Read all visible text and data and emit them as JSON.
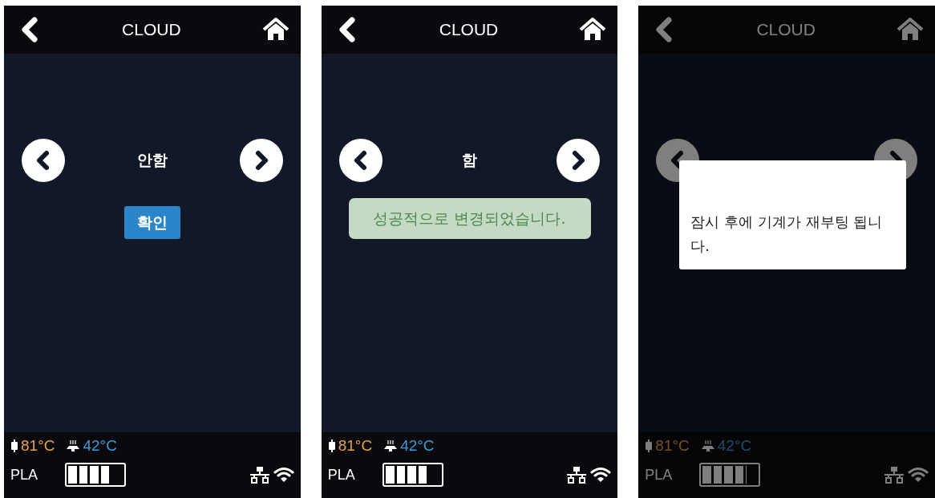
{
  "screens": [
    {
      "title": "CLOUD",
      "dimmed": false,
      "value": "안함",
      "confirm_button": "확인",
      "status": {
        "nozzle_temp": "81°C",
        "bed_temp": "42°C",
        "material": "PLA",
        "level": 0.8
      }
    },
    {
      "title": "CLOUD",
      "dimmed": false,
      "value": "함",
      "toast": "성공적으로 변경되었습니다.",
      "status": {
        "nozzle_temp": "81°C",
        "bed_temp": "42°C",
        "material": "PLA",
        "level": 0.8
      }
    },
    {
      "title": "CLOUD",
      "dimmed": true,
      "dialog": "잠시 후에 기계가 재부팅 됩니다.",
      "status": {
        "nozzle_temp": "81°C",
        "bed_temp": "42°C",
        "material": "PLA",
        "level": 0.8
      }
    }
  ]
}
